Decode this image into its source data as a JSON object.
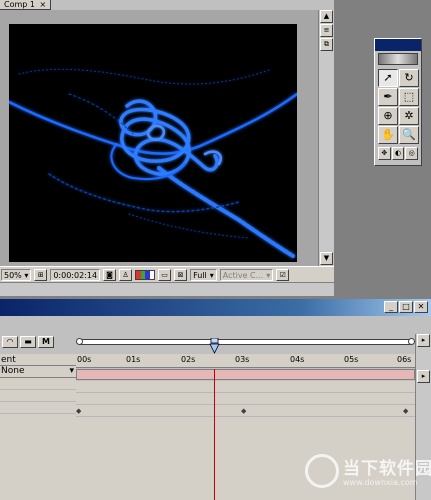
{
  "comp": {
    "tab_label": "Comp 1",
    "tab_close": "×",
    "zoom": "50%",
    "timecode": "0:00:02:14",
    "resolution": "Full",
    "view": "Active C...",
    "colors": {
      "stage_bg": "#000000",
      "stroke": "#1e6bff",
      "stroke_glow": "#4a8cff"
    }
  },
  "tools": {
    "items": [
      "selection-tool",
      "rotation-tool",
      "pen-tool",
      "mask-tool",
      "pan-behind-tool",
      "orbit-tool",
      "hand-tool",
      "zoom-tool"
    ]
  },
  "timeline": {
    "layer_header": "ent",
    "mode_value": "None",
    "ruler_ticks": [
      "00s",
      "01s",
      "02s",
      "03s",
      "04s",
      "05s",
      "06s"
    ],
    "current_time_fraction": 0.41,
    "colors": {
      "work_area": "#e6b7b7",
      "playhead": "#c00000",
      "titlebar": "#0a246a"
    }
  },
  "watermark": {
    "title": "当下软件园",
    "url": "www.downxia.com"
  }
}
